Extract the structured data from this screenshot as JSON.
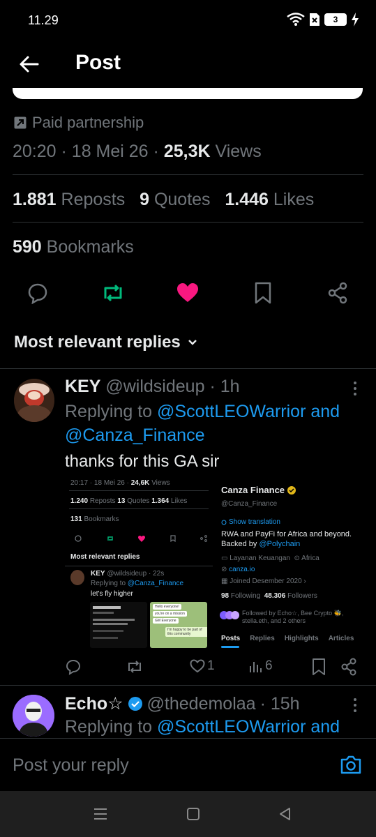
{
  "status_bar": {
    "time": "11.29",
    "battery": "3"
  },
  "header": {
    "title": "Post"
  },
  "post_meta": {
    "paid": "Paid partnership",
    "time": "20:20",
    "date": "18 Mei 26",
    "views_count": "25,3K",
    "views_label": "Views",
    "sep": "·"
  },
  "stats": {
    "reposts_count": "1.881",
    "reposts_label": "Reposts",
    "quotes_count": "9",
    "quotes_label": "Quotes",
    "likes_count": "1.446",
    "likes_label": "Likes",
    "bookmarks_count": "590",
    "bookmarks_label": "Bookmarks"
  },
  "replies_filter": {
    "label": "Most relevant replies"
  },
  "reply1": {
    "name": "KEY",
    "handle": "@wildsideup",
    "time": "· 1h",
    "replying_prefix": "Replying to",
    "mention1": "@ScottLEOWarrior and",
    "mention2": "@Canza_Finance",
    "text": "thanks for this GA sir",
    "reply_count": "",
    "like_count": "1",
    "views_count": "6",
    "embedded_left": {
      "meta": "20:17 · 18 Mei 26 ·",
      "views": "24,6K",
      "views_label": "Views",
      "reposts": "1.240",
      "reposts_label": "Reposts",
      "quotes": "13",
      "quotes_label": "Quotes",
      "likes": "1.364",
      "likes_label": "Likes",
      "bookmarks": "131",
      "bookmarks_label": "Bookmarks",
      "most_relevant": "Most relevant replies",
      "nested_name": "KEY",
      "nested_handle": "@wildsideup · 22s",
      "nested_replying": "Replying to",
      "nested_mention": "@Canza_Finance",
      "nested_text": "let's fly higher",
      "chat1": "Hello everyone!",
      "chat2": "you're on a mission",
      "chat3": "GM Everyone",
      "chat4": "I'm happy to be part of this community"
    },
    "embedded_right": {
      "name": "Canza Finance",
      "handle": "@Canza_Finance",
      "show_translation": "Show translation",
      "bio1": "RWA and PayFi for Africa and beyond.",
      "bio2_prefix": "Backed by",
      "bio2_mention": "@Polychain",
      "category": "Layanan Keuangan",
      "location": "Africa",
      "link": "canza.io",
      "joined": "Joined Desember 2020",
      "following_count": "98",
      "following_label": "Following",
      "followers_count": "48.306",
      "followers_label": "Followers",
      "followed_by": "Followed by Echo☆, Bee Crypto 🐝,",
      "followed_by2": "stella.eth, and 2 others",
      "tabs": [
        "Posts",
        "Replies",
        "Highlights",
        "Articles"
      ]
    }
  },
  "reply2": {
    "name": "Echo☆",
    "handle": "@thedemolaa",
    "time": "· 15h",
    "replying_prefix": "Replying to",
    "mention1": "@ScottLEOWarrior and"
  },
  "composer": {
    "placeholder": "Post your reply"
  },
  "colors": {
    "accent": "#1d9bf0",
    "like": "#f91880",
    "repost": "#00ba7c",
    "background": "#000000"
  }
}
